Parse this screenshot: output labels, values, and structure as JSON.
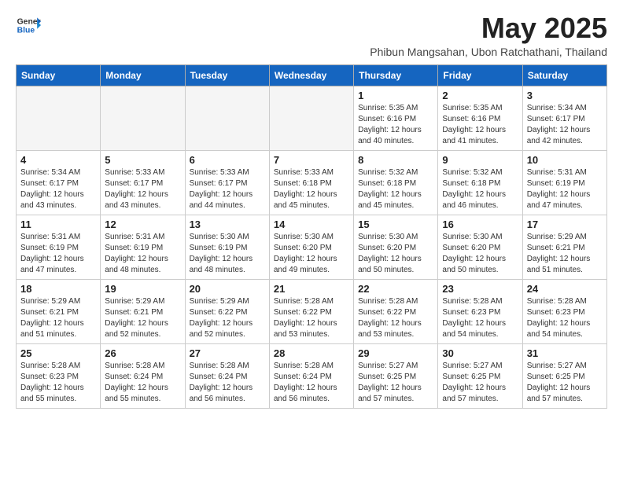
{
  "header": {
    "logo_general": "General",
    "logo_blue": "Blue",
    "month_title": "May 2025",
    "subtitle": "Phibun Mangsahan, Ubon Ratchathani, Thailand"
  },
  "weekdays": [
    "Sunday",
    "Monday",
    "Tuesday",
    "Wednesday",
    "Thursday",
    "Friday",
    "Saturday"
  ],
  "weeks": [
    [
      {
        "day": "",
        "detail": ""
      },
      {
        "day": "",
        "detail": ""
      },
      {
        "day": "",
        "detail": ""
      },
      {
        "day": "",
        "detail": ""
      },
      {
        "day": "1",
        "detail": "Sunrise: 5:35 AM\nSunset: 6:16 PM\nDaylight: 12 hours\nand 40 minutes."
      },
      {
        "day": "2",
        "detail": "Sunrise: 5:35 AM\nSunset: 6:16 PM\nDaylight: 12 hours\nand 41 minutes."
      },
      {
        "day": "3",
        "detail": "Sunrise: 5:34 AM\nSunset: 6:17 PM\nDaylight: 12 hours\nand 42 minutes."
      }
    ],
    [
      {
        "day": "4",
        "detail": "Sunrise: 5:34 AM\nSunset: 6:17 PM\nDaylight: 12 hours\nand 43 minutes."
      },
      {
        "day": "5",
        "detail": "Sunrise: 5:33 AM\nSunset: 6:17 PM\nDaylight: 12 hours\nand 43 minutes."
      },
      {
        "day": "6",
        "detail": "Sunrise: 5:33 AM\nSunset: 6:17 PM\nDaylight: 12 hours\nand 44 minutes."
      },
      {
        "day": "7",
        "detail": "Sunrise: 5:33 AM\nSunset: 6:18 PM\nDaylight: 12 hours\nand 45 minutes."
      },
      {
        "day": "8",
        "detail": "Sunrise: 5:32 AM\nSunset: 6:18 PM\nDaylight: 12 hours\nand 45 minutes."
      },
      {
        "day": "9",
        "detail": "Sunrise: 5:32 AM\nSunset: 6:18 PM\nDaylight: 12 hours\nand 46 minutes."
      },
      {
        "day": "10",
        "detail": "Sunrise: 5:31 AM\nSunset: 6:19 PM\nDaylight: 12 hours\nand 47 minutes."
      }
    ],
    [
      {
        "day": "11",
        "detail": "Sunrise: 5:31 AM\nSunset: 6:19 PM\nDaylight: 12 hours\nand 47 minutes."
      },
      {
        "day": "12",
        "detail": "Sunrise: 5:31 AM\nSunset: 6:19 PM\nDaylight: 12 hours\nand 48 minutes."
      },
      {
        "day": "13",
        "detail": "Sunrise: 5:30 AM\nSunset: 6:19 PM\nDaylight: 12 hours\nand 48 minutes."
      },
      {
        "day": "14",
        "detail": "Sunrise: 5:30 AM\nSunset: 6:20 PM\nDaylight: 12 hours\nand 49 minutes."
      },
      {
        "day": "15",
        "detail": "Sunrise: 5:30 AM\nSunset: 6:20 PM\nDaylight: 12 hours\nand 50 minutes."
      },
      {
        "day": "16",
        "detail": "Sunrise: 5:30 AM\nSunset: 6:20 PM\nDaylight: 12 hours\nand 50 minutes."
      },
      {
        "day": "17",
        "detail": "Sunrise: 5:29 AM\nSunset: 6:21 PM\nDaylight: 12 hours\nand 51 minutes."
      }
    ],
    [
      {
        "day": "18",
        "detail": "Sunrise: 5:29 AM\nSunset: 6:21 PM\nDaylight: 12 hours\nand 51 minutes."
      },
      {
        "day": "19",
        "detail": "Sunrise: 5:29 AM\nSunset: 6:21 PM\nDaylight: 12 hours\nand 52 minutes."
      },
      {
        "day": "20",
        "detail": "Sunrise: 5:29 AM\nSunset: 6:22 PM\nDaylight: 12 hours\nand 52 minutes."
      },
      {
        "day": "21",
        "detail": "Sunrise: 5:28 AM\nSunset: 6:22 PM\nDaylight: 12 hours\nand 53 minutes."
      },
      {
        "day": "22",
        "detail": "Sunrise: 5:28 AM\nSunset: 6:22 PM\nDaylight: 12 hours\nand 53 minutes."
      },
      {
        "day": "23",
        "detail": "Sunrise: 5:28 AM\nSunset: 6:23 PM\nDaylight: 12 hours\nand 54 minutes."
      },
      {
        "day": "24",
        "detail": "Sunrise: 5:28 AM\nSunset: 6:23 PM\nDaylight: 12 hours\nand 54 minutes."
      }
    ],
    [
      {
        "day": "25",
        "detail": "Sunrise: 5:28 AM\nSunset: 6:23 PM\nDaylight: 12 hours\nand 55 minutes."
      },
      {
        "day": "26",
        "detail": "Sunrise: 5:28 AM\nSunset: 6:24 PM\nDaylight: 12 hours\nand 55 minutes."
      },
      {
        "day": "27",
        "detail": "Sunrise: 5:28 AM\nSunset: 6:24 PM\nDaylight: 12 hours\nand 56 minutes."
      },
      {
        "day": "28",
        "detail": "Sunrise: 5:28 AM\nSunset: 6:24 PM\nDaylight: 12 hours\nand 56 minutes."
      },
      {
        "day": "29",
        "detail": "Sunrise: 5:27 AM\nSunset: 6:25 PM\nDaylight: 12 hours\nand 57 minutes."
      },
      {
        "day": "30",
        "detail": "Sunrise: 5:27 AM\nSunset: 6:25 PM\nDaylight: 12 hours\nand 57 minutes."
      },
      {
        "day": "31",
        "detail": "Sunrise: 5:27 AM\nSunset: 6:25 PM\nDaylight: 12 hours\nand 57 minutes."
      }
    ]
  ]
}
